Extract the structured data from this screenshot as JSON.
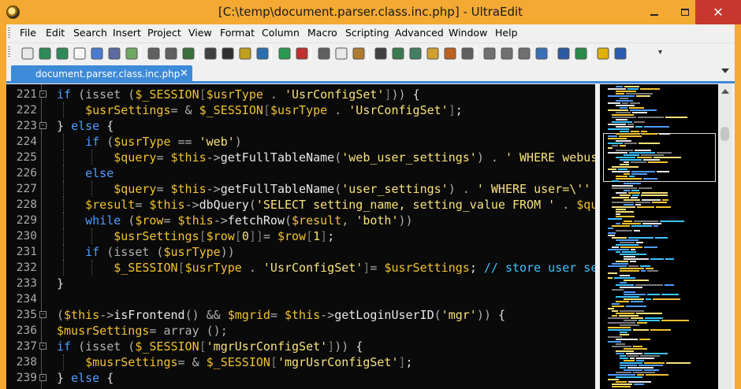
{
  "window": {
    "title": "[C:\\temp\\document.parser.class.inc.php] - UltraEdit",
    "close_glyph": "✕"
  },
  "menu": [
    "File",
    "Edit",
    "Search",
    "Insert",
    "Project",
    "View",
    "Format",
    "Column",
    "Macro",
    "Scripting",
    "Advanced",
    "Window",
    "Help"
  ],
  "toolbar": {
    "overflow_glyph": "▾",
    "icons": [
      "new-file-icon",
      "back-icon",
      "forward-icon",
      "new-document-icon",
      "open-icon",
      "save-icon",
      "image-icon",
      "print-icon",
      "print-preview-icon",
      "list-icon",
      "spellcheck-icon",
      "column-mode-icon",
      "word-wrap-icon",
      "web-icon",
      "back-circle-icon",
      "record-icon",
      "cut-icon",
      "copy-icon",
      "paste-icon",
      "binoculars-icon",
      "replace-icon",
      "find-files-icon",
      "ftp-icon",
      "compare-icon",
      "macro-icon",
      "window-horizontal-icon",
      "window-vertical-icon",
      "window-cascade-icon",
      "globe-icon",
      "browser-icon",
      "refresh-icon",
      "tip-icon",
      "help-icon"
    ]
  },
  "tab": {
    "label": "document.parser.class.inc.php",
    "close_glyph": "✕"
  },
  "editor": {
    "lines": [
      {
        "n": "221",
        "fold": "-",
        "tokens": [
          [
            "kw",
            "if "
          ],
          [
            "op",
            "(isset ("
          ],
          [
            "var",
            "$_SESSION"
          ],
          [
            "brk",
            "["
          ],
          [
            "var",
            "$usrType"
          ],
          [
            "op",
            " . "
          ],
          [
            "str",
            "'UsrConfigSet'"
          ],
          [
            "brk",
            "]"
          ],
          [
            "op",
            ")) "
          ],
          [
            "sym",
            "{"
          ]
        ]
      },
      {
        "n": "222",
        "fold": "",
        "tokens": [
          [
            "sym",
            "    "
          ],
          [
            "var",
            "$usrSettings"
          ],
          [
            "op",
            "= & "
          ],
          [
            "var",
            "$_SESSION"
          ],
          [
            "brk",
            "["
          ],
          [
            "var",
            "$usrType"
          ],
          [
            "op",
            " . "
          ],
          [
            "str",
            "'UsrConfigSet'"
          ],
          [
            "brk",
            "]"
          ],
          [
            "sym",
            ";"
          ]
        ]
      },
      {
        "n": "223",
        "fold": "-",
        "tokens": [
          [
            "sym",
            "} "
          ],
          [
            "kw",
            "else "
          ],
          [
            "sym",
            "{"
          ]
        ]
      },
      {
        "n": "224",
        "fold": "",
        "tokens": [
          [
            "sym",
            "    "
          ],
          [
            "kw",
            "if "
          ],
          [
            "op",
            "("
          ],
          [
            "var",
            "$usrType"
          ],
          [
            "op",
            " == "
          ],
          [
            "str",
            "'web'"
          ],
          [
            "op",
            ")"
          ]
        ]
      },
      {
        "n": "225",
        "fold": "",
        "tokens": [
          [
            "sym",
            "        "
          ],
          [
            "var",
            "$query"
          ],
          [
            "op",
            "= "
          ],
          [
            "var",
            "$this"
          ],
          [
            "op",
            "->"
          ],
          [
            "fn",
            "getFullTableName"
          ],
          [
            "op",
            "("
          ],
          [
            "str",
            "'web_user_settings'"
          ],
          [
            "op",
            ") . "
          ],
          [
            "str",
            "' WHERE webus"
          ]
        ]
      },
      {
        "n": "226",
        "fold": "",
        "tokens": [
          [
            "sym",
            "    "
          ],
          [
            "kw",
            "else"
          ]
        ]
      },
      {
        "n": "227",
        "fold": "",
        "tokens": [
          [
            "sym",
            "        "
          ],
          [
            "var",
            "$query"
          ],
          [
            "op",
            "= "
          ],
          [
            "var",
            "$this"
          ],
          [
            "op",
            "->"
          ],
          [
            "fn",
            "getFullTableName"
          ],
          [
            "op",
            "("
          ],
          [
            "str",
            "'user_settings'"
          ],
          [
            "op",
            ") . "
          ],
          [
            "str",
            "' WHERE user=\\''"
          ]
        ]
      },
      {
        "n": "228",
        "fold": "",
        "tokens": [
          [
            "sym",
            "    "
          ],
          [
            "var",
            "$result"
          ],
          [
            "op",
            "= "
          ],
          [
            "var",
            "$this"
          ],
          [
            "op",
            "->"
          ],
          [
            "fn",
            "dbQuery"
          ],
          [
            "op",
            "("
          ],
          [
            "str",
            "'SELECT setting_name, setting_value FROM '"
          ],
          [
            "op",
            " . "
          ],
          [
            "var",
            "$qu"
          ]
        ]
      },
      {
        "n": "229",
        "fold": "",
        "tokens": [
          [
            "sym",
            "    "
          ],
          [
            "kw",
            "while "
          ],
          [
            "op",
            "("
          ],
          [
            "var",
            "$row"
          ],
          [
            "op",
            "= "
          ],
          [
            "var",
            "$this"
          ],
          [
            "op",
            "->"
          ],
          [
            "fn",
            "fetchRow"
          ],
          [
            "op",
            "("
          ],
          [
            "var",
            "$result"
          ],
          [
            "op",
            ", "
          ],
          [
            "str",
            "'both'"
          ],
          [
            "op",
            "))"
          ]
        ]
      },
      {
        "n": "230",
        "fold": "",
        "tokens": [
          [
            "sym",
            "        "
          ],
          [
            "var",
            "$usrSettings"
          ],
          [
            "brk",
            "["
          ],
          [
            "var",
            "$row"
          ],
          [
            "brk",
            "["
          ],
          [
            "str",
            "0"
          ],
          [
            "brk",
            "]]"
          ],
          [
            "op",
            "= "
          ],
          [
            "var",
            "$row"
          ],
          [
            "brk",
            "["
          ],
          [
            "str",
            "1"
          ],
          [
            "brk",
            "]"
          ],
          [
            "sym",
            ";"
          ]
        ]
      },
      {
        "n": "231",
        "fold": "",
        "tokens": [
          [
            "sym",
            "    "
          ],
          [
            "kw",
            "if "
          ],
          [
            "op",
            "(isset ("
          ],
          [
            "var",
            "$usrType"
          ],
          [
            "op",
            "))"
          ]
        ]
      },
      {
        "n": "232",
        "fold": "",
        "tokens": [
          [
            "sym",
            "        "
          ],
          [
            "var",
            "$_SESSION"
          ],
          [
            "brk",
            "["
          ],
          [
            "var",
            "$usrType"
          ],
          [
            "op",
            " . "
          ],
          [
            "str",
            "'UsrConfigSet'"
          ],
          [
            "brk",
            "]"
          ],
          [
            "op",
            "= "
          ],
          [
            "var",
            "$usrSettings"
          ],
          [
            "sym",
            "; "
          ],
          [
            "cmt",
            "// store user se"
          ]
        ]
      },
      {
        "n": "233",
        "fold": "",
        "tokens": [
          [
            "sym",
            "}"
          ]
        ]
      },
      {
        "n": "234",
        "fold": "",
        "tokens": []
      },
      {
        "n": "235",
        "fold": "-",
        "tokens": [
          [
            "op",
            "("
          ],
          [
            "var",
            "$this"
          ],
          [
            "op",
            "->"
          ],
          [
            "fn",
            "isFrontend"
          ],
          [
            "op",
            "() && "
          ],
          [
            "var",
            "$mgrid"
          ],
          [
            "op",
            "= "
          ],
          [
            "var",
            "$this"
          ],
          [
            "op",
            "->"
          ],
          [
            "fn",
            "getLoginUserID"
          ],
          [
            "op",
            "("
          ],
          [
            "str",
            "'mgr'"
          ],
          [
            "op",
            ")) "
          ],
          [
            "sym",
            "{"
          ]
        ]
      },
      {
        "n": "236",
        "fold": "",
        "tokens": [
          [
            "var",
            "$musrSettings"
          ],
          [
            "op",
            "= array ();"
          ]
        ]
      },
      {
        "n": "237",
        "fold": "-",
        "tokens": [
          [
            "kw",
            "if "
          ],
          [
            "op",
            "(isset ("
          ],
          [
            "var",
            "$_SESSION"
          ],
          [
            "brk",
            "["
          ],
          [
            "str",
            "'mgrUsrConfigSet'"
          ],
          [
            "brk",
            "]"
          ],
          [
            "op",
            ")) "
          ],
          [
            "sym",
            "{"
          ]
        ]
      },
      {
        "n": "238",
        "fold": "",
        "tokens": [
          [
            "sym",
            "    "
          ],
          [
            "var",
            "$musrSettings"
          ],
          [
            "op",
            "= & "
          ],
          [
            "var",
            "$_SESSION"
          ],
          [
            "brk",
            "["
          ],
          [
            "str",
            "'mgrUsrConfigSet'"
          ],
          [
            "brk",
            "]"
          ],
          [
            "sym",
            ";"
          ]
        ]
      },
      {
        "n": "239",
        "fold": "-",
        "tokens": [
          [
            "sym",
            "} "
          ],
          [
            "kw",
            "else "
          ],
          [
            "sym",
            "{"
          ]
        ]
      }
    ]
  },
  "colors": {
    "titlebar": "#f3a932",
    "tab_active": "#3d8ad8",
    "editor_bg": "#0a0a0a",
    "close_button": "#c8372d"
  }
}
